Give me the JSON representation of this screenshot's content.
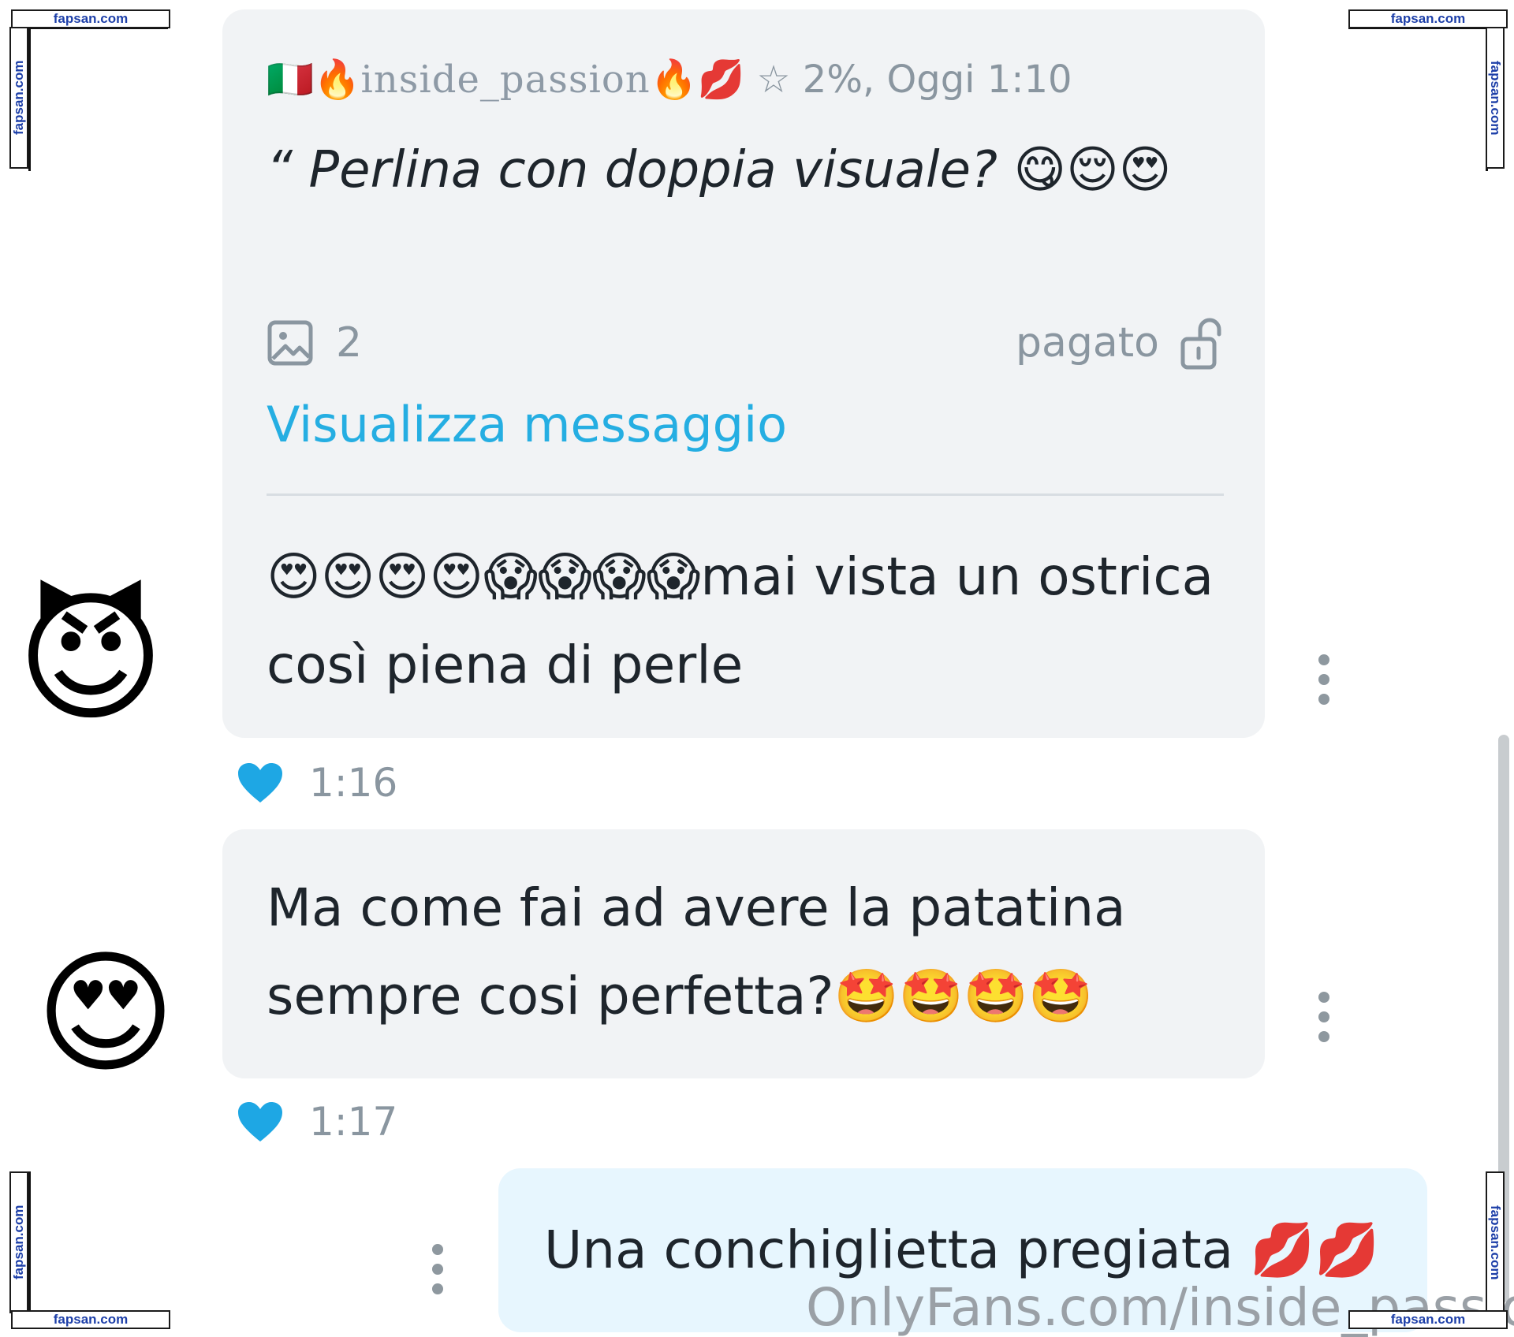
{
  "watermark": {
    "label": "fapsan.com"
  },
  "quoted": {
    "flag": "🇮🇹",
    "fire": "🔥",
    "kiss": "💋",
    "name": "inside_passion",
    "star": "☆",
    "meta": "2%, Oggi 1:10",
    "text": "“ Perlina con doppia visuale? 😋😌😍",
    "media_count": "2",
    "paid_label": "pagato",
    "view_label": "Visualizza messaggio"
  },
  "messages": [
    {
      "avatar": "😈",
      "text": "😍😍😍😍😱😱😱😱mai vista un ostrica così piena di perle",
      "time": "1:16"
    },
    {
      "avatar": "😍",
      "text": "Ma come fai ad avere la patatina sempre cosi perfetta?🤩🤩🤩🤩",
      "time": "1:17"
    },
    {
      "text": "Una conchiglietta pregiata 💋💋"
    }
  ],
  "footer": {
    "watermark": "OnlyFans.com/inside_passion"
  },
  "colors": {
    "accent": "#25aee2",
    "heart": "#1ea7e4",
    "bubble_in": "#f1f3f5",
    "bubble_out": "#e7f6fe",
    "watermark_text": "#1d3fa8"
  },
  "icons": [
    "image-icon",
    "unlock-icon",
    "heart-icon",
    "more-vertical-icon"
  ]
}
